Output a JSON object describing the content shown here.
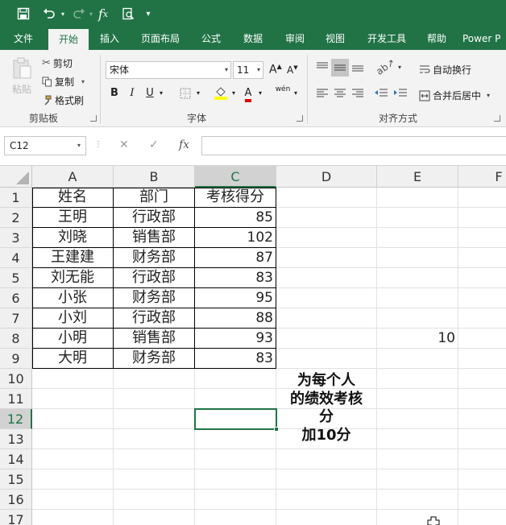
{
  "qat": {
    "icons": [
      "save-icon",
      "undo-icon",
      "redo-icon",
      "function-icon",
      "print-preview-icon",
      "customize-icon"
    ]
  },
  "tabs": [
    "文件",
    "开始",
    "插入",
    "页面布局",
    "公式",
    "数据",
    "审阅",
    "视图",
    "开发工具",
    "帮助",
    "Power P"
  ],
  "active_tab": "开始",
  "ribbon": {
    "clipboard": {
      "paste_label": "粘贴",
      "cut_label": "剪切",
      "copy_label": "复制",
      "format_painter_label": "格式刷",
      "group_label": "剪贴板"
    },
    "font": {
      "font_name": "宋体",
      "font_size": "11",
      "bold": "B",
      "italic": "I",
      "underline": "U",
      "font_color_glyph": "A",
      "phonetic": "wén",
      "group_label": "字体"
    },
    "alignment": {
      "wrap_text_label": "自动换行",
      "merge_center_label": "合并后居中",
      "group_label": "对齐方式"
    }
  },
  "formula_bar": {
    "name_box": "C12",
    "fx": "fx",
    "value": ""
  },
  "colors": {
    "excel_green": "#217346"
  },
  "columns": [
    "A",
    "B",
    "C",
    "D",
    "E",
    "F"
  ],
  "rows": [
    "1",
    "2",
    "3",
    "4",
    "5",
    "6",
    "7",
    "8",
    "9",
    "10",
    "11",
    "12",
    "13",
    "14",
    "15",
    "16",
    "17"
  ],
  "table": {
    "headers": [
      "姓名",
      "部门",
      "考核得分"
    ],
    "records": [
      [
        "王明",
        "行政部",
        "85"
      ],
      [
        "刘晓",
        "销售部",
        "102"
      ],
      [
        "王建建",
        "财务部",
        "87"
      ],
      [
        "刘无能",
        "行政部",
        "83"
      ],
      [
        "小张",
        "财务部",
        "95"
      ],
      [
        "小刘",
        "行政部",
        "88"
      ],
      [
        "小明",
        "销售部",
        "93"
      ],
      [
        "大明",
        "财务部",
        "83"
      ]
    ]
  },
  "note_lines": [
    "为每个人",
    "的绩效考核",
    "分",
    "加10分"
  ],
  "e8_value": "10",
  "selected_cell": "C12"
}
